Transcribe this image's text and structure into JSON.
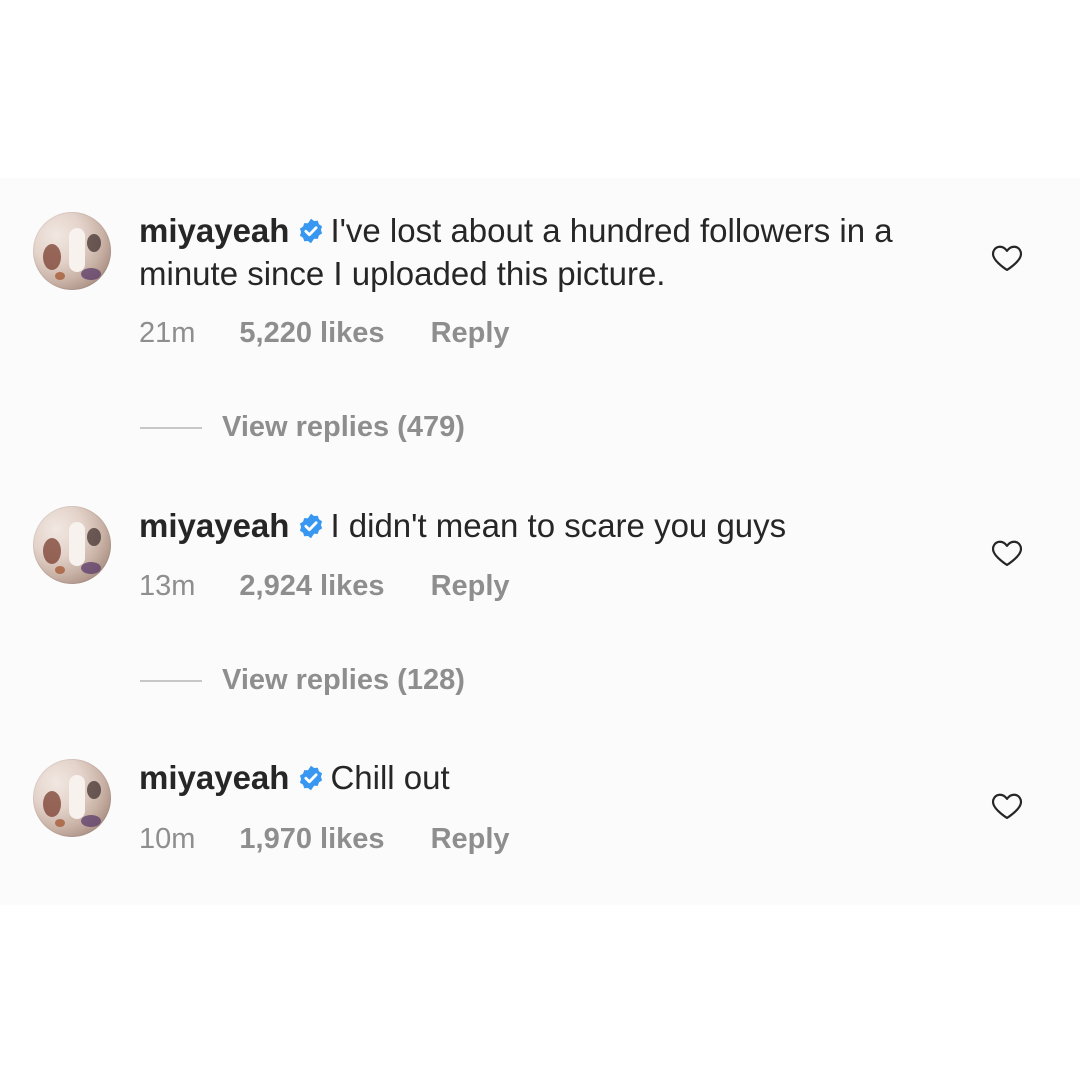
{
  "comments": [
    {
      "username": "miyayeah",
      "text": "I've lost about a hundred followers in a minute since I uploaded this picture.",
      "time": "21m",
      "likes": "5,220 likes",
      "reply_label": "Reply",
      "view_replies": "View replies (479)"
    },
    {
      "username": "miyayeah",
      "text": "I didn't mean to scare you guys",
      "time": "13m",
      "likes": "2,924 likes",
      "reply_label": "Reply",
      "view_replies": "View replies (128)"
    },
    {
      "username": "miyayeah",
      "text": "Chill out",
      "time": "10m",
      "likes": "1,970 likes",
      "reply_label": "Reply"
    }
  ],
  "icons": {
    "verified": "verified-badge-icon",
    "like": "heart-outline-icon"
  },
  "colors": {
    "verified_blue": "#3897f0",
    "text_primary": "#262626",
    "text_secondary": "#8e8e8e"
  }
}
